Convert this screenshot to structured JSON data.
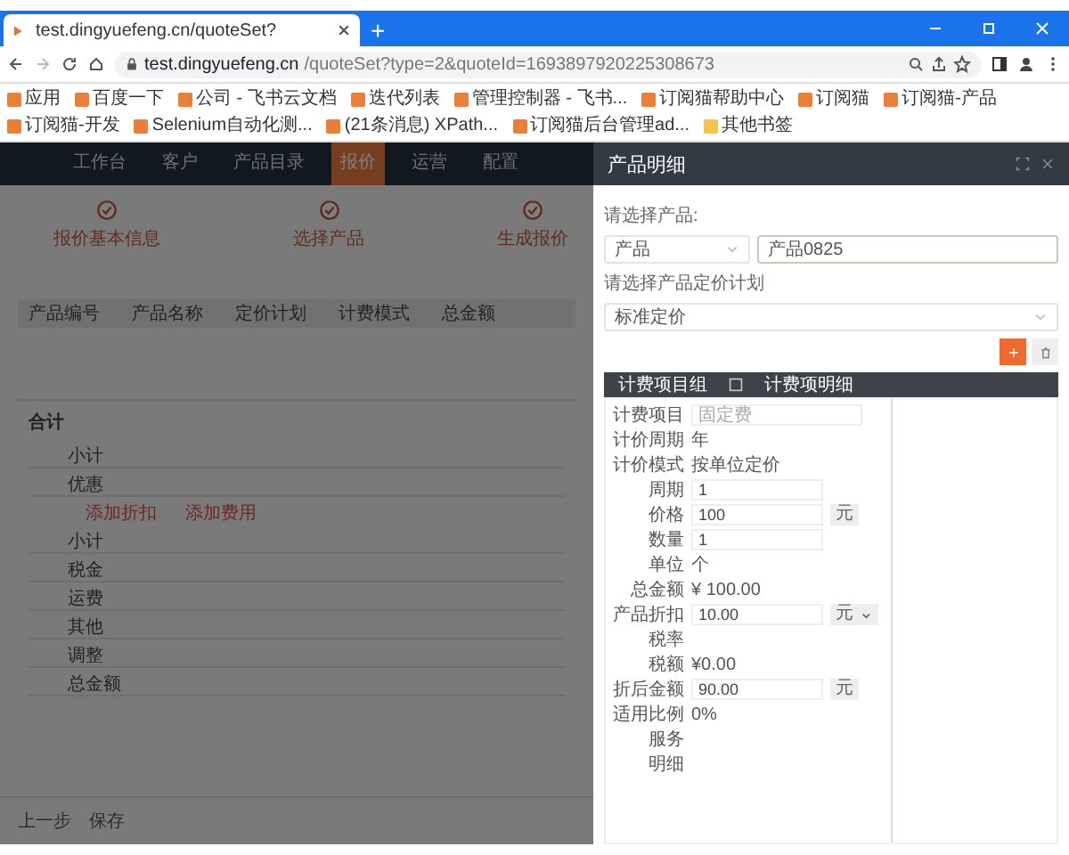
{
  "browser": {
    "tab_title": "test.dingyuefeng.cn/quoteSet?",
    "new_tab": "+",
    "url_host": "test.dingyuefeng.cn",
    "url_path": "/quoteSet?type=2&quoteId=1693897920225308673",
    "bookmarks": [
      {
        "label": "应用"
      },
      {
        "label": "百度一下"
      },
      {
        "label": "公司 - 飞书云文档"
      },
      {
        "label": "迭代列表"
      },
      {
        "label": "管理控制器 - 飞书..."
      },
      {
        "label": "订阅猫帮助中心"
      },
      {
        "label": "订阅猫"
      },
      {
        "label": "订阅猫-产品"
      },
      {
        "label": "订阅猫-开发"
      },
      {
        "label": "Selenium自动化测..."
      },
      {
        "label": "(21条消息) XPath..."
      },
      {
        "label": "订阅猫后台管理ad..."
      },
      {
        "label": "其他书签"
      }
    ]
  },
  "app": {
    "nav": [
      {
        "label": "工作台",
        "selected": false
      },
      {
        "label": "客户",
        "selected": false
      },
      {
        "label": "产品目录",
        "selected": false
      },
      {
        "label": "报价",
        "selected": true
      },
      {
        "label": "运营",
        "selected": false
      },
      {
        "label": "配置",
        "selected": false
      }
    ],
    "steps": [
      {
        "label": "报价基本信息",
        "done": true
      },
      {
        "label": "选择产品",
        "done": true
      },
      {
        "label": "生成报价",
        "done": true
      }
    ],
    "table": {
      "columns": [
        "产品编号",
        "产品名称",
        "定价计划",
        "计费模式",
        "总金额"
      ]
    },
    "summary": {
      "title": "合计",
      "rows_top": [
        "小计",
        "优惠"
      ],
      "links": [
        "添加折扣",
        "添加费用"
      ],
      "rows": [
        "小计",
        "税金",
        "运费",
        "其他",
        "调整",
        "总金额"
      ]
    },
    "footer": [
      "上一步",
      "保存"
    ]
  },
  "drawer": {
    "title": "产品明细",
    "product_label": "请选择产品:",
    "product_type": "产品",
    "product_name": "产品0825",
    "plan_label": "请选择产品定价计划",
    "plan": "标准定价",
    "grid_header": [
      "计费项目组",
      "计费项明细"
    ],
    "fields": [
      {
        "label": "计费项目",
        "kind": "select",
        "placeholder": "固定费"
      },
      {
        "label": "计价周期",
        "kind": "text",
        "value": "年"
      },
      {
        "label": "计价模式",
        "kind": "text",
        "value": "按单位定价"
      },
      {
        "label": "周期",
        "kind": "input",
        "value": "1"
      },
      {
        "label": "价格",
        "kind": "input",
        "value": "100",
        "unit": "元"
      },
      {
        "label": "数量",
        "kind": "input",
        "value": "1"
      },
      {
        "label": "单位",
        "kind": "text",
        "value": "个"
      },
      {
        "label": "总金额",
        "kind": "text",
        "value": "¥ 100.00"
      },
      {
        "label": "产品折扣",
        "kind": "input",
        "value": "10.00",
        "unit": "元 ⌄"
      },
      {
        "label": "税率",
        "kind": "text"
      },
      {
        "label": "税额",
        "kind": "text",
        "value": "¥0.00"
      },
      {
        "label": "折后金额",
        "kind": "input",
        "value": "90.00",
        "unit": "元"
      },
      {
        "label": "适用比例",
        "kind": "text",
        "value": "0%"
      },
      {
        "label": "服务",
        "kind": "text"
      },
      {
        "label": "明细",
        "kind": "text"
      }
    ]
  }
}
